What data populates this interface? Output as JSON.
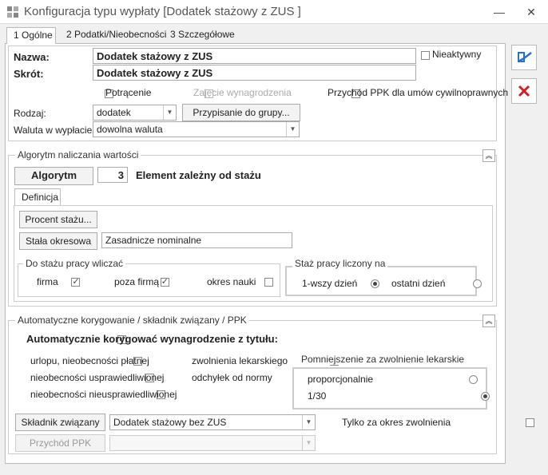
{
  "window": {
    "title": "Konfiguracja typu wypłaty [Dodatek stażowy z ZUS ]",
    "minimize_glyph": "—",
    "close_glyph": "✕"
  },
  "tabs": [
    {
      "label": "1 Ogólne"
    },
    {
      "label": "2 Podatki/Nieobecności"
    },
    {
      "label": "3 Szczegółowe"
    }
  ],
  "general": {
    "name_label": "Nazwa:",
    "name_value": "Dodatek stażowy z ZUS",
    "short_label": "Skrót:",
    "short_value": "Dodatek stażowy z ZUS",
    "inactive_label": "Nieaktywny",
    "deduction_label": "Potrącenie",
    "salary_seizure_label": "Zajęcie wynagrodzenia",
    "ppk_label": "Przychód PPK dla umów cywilnoprawnych",
    "type_label": "Rodzaj:",
    "type_value": "dodatek",
    "assign_group_label": "Przypisanie do grupy...",
    "currency_label": "Waluta w wypłacie:",
    "currency_value": "dowolna waluta"
  },
  "algorithm": {
    "section_title": "Algorytm naliczania wartości",
    "button_label": "Algorytm",
    "number": "3",
    "description": "Element zależny od stażu",
    "definition_tab": "Definicja",
    "percent_button": "Procent stażu...",
    "constant_button": "Stała okresowa",
    "constant_value": "Zasadnicze nominalne",
    "seniority_group_title": "Do stażu pracy wliczać",
    "seniority_company": "firma",
    "seniority_outside": "poza firmą",
    "seniority_study": "okres nauki",
    "counted_group_title": "Staż pracy liczony na",
    "counted_first": "1-wszy dzień",
    "counted_last": "ostatni dzień"
  },
  "auto": {
    "section_title": "Automatyczne korygowanie / składnik związany / PPK",
    "main_label": "Automatycznie korygować wynagrodzenie z tytułu:",
    "leave_paid": "urlopu, nieobecności płatnej",
    "absence_excused": "nieobecności usprawiedliwionej",
    "absence_unexcused": "nieobecności nieusprawiedliwionej",
    "sick_leave": "zwolnienia lekarskiego",
    "deviation": "odchyłek od normy",
    "reduction_group_title": "Pomniejszenie za zwolnienie lekarskie",
    "proportional": "proporcjonalnie",
    "one_thirtieth": "1/30",
    "related_button": "Składnik związany",
    "related_value": "Dodatek stażowy bez ZUS",
    "only_leave_label": "Tylko za okres zwolnienia",
    "ppk_button": "Przychód PPK",
    "ppk_value": ""
  },
  "colors": {
    "save_icon_blue": "#2a6fc9",
    "cancel_icon_red": "#d21f1f"
  }
}
